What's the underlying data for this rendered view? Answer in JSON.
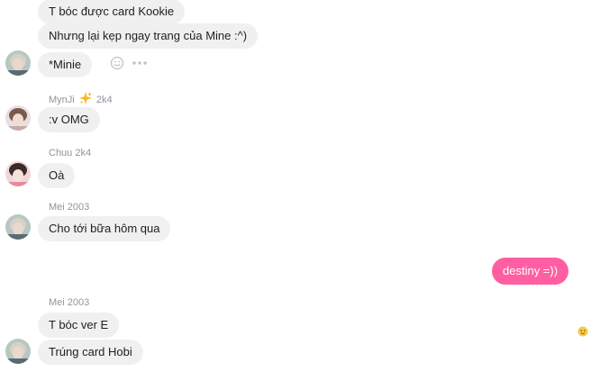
{
  "messages": {
    "m1": "T bóc được card Kookie",
    "m2": "Nhưng lại kẹp ngay trang của Mine :^)",
    "m3": "*Minie",
    "m4": ":v OMG",
    "m5": "Oà",
    "m6": "Cho tới bữa hôm qua",
    "m7": "destiny =))",
    "m8": "T bóc ver E",
    "m9": "Trúng card Hobi"
  },
  "senders": {
    "s1_name": "MynJi",
    "s1_suffix": "2k4",
    "s2": "Chuu 2k4",
    "s3": "Mei 2003",
    "s4": "Mei 2003"
  },
  "icons": {
    "reaction": "smiley-icon",
    "more": "more-dots-icon",
    "badge": "sparkle-emoji-icon",
    "seen": "seen-avatar-icon"
  },
  "colors": {
    "incoming_bubble": "#f1f0f0",
    "outgoing_bubble": "#ff5fa2",
    "sender_text": "#90949c"
  }
}
